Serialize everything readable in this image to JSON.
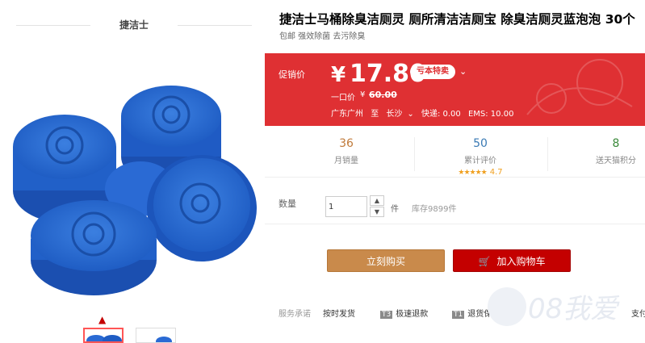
{
  "gallery": {
    "brand_name": "捷洁士",
    "thumb_up_icon": "chevron-up-icon"
  },
  "product": {
    "title": "捷洁士马桶除臭洁厕灵 厕所清洁洁厕宝 除臭洁厕灵蓝泡泡 30个",
    "subtitle": "包邮 强效除菌 去污除臭"
  },
  "price_box": {
    "label": "促销价",
    "currency": "¥",
    "price": "17.80",
    "badge": "亏本特卖",
    "original_label": "一口价",
    "original_currency": "¥",
    "original_price": "60.00",
    "origin": "广东广州",
    "to": "至",
    "destination": "长沙",
    "express": "快递: 0.00",
    "ems": "EMS: 10.00"
  },
  "stats": [
    {
      "value": "36",
      "label": "月销量"
    },
    {
      "value": "50",
      "label": "累计评价",
      "rating": "4.7"
    },
    {
      "value": "8",
      "label": "送天猫积分"
    }
  ],
  "quantity": {
    "label": "数量",
    "value": "1",
    "unit": "件",
    "stock": "库存9899件"
  },
  "actions": {
    "buy_now": "立刻购买",
    "add_cart": "加入购物车"
  },
  "service": {
    "label": "服务承诺",
    "items": [
      {
        "tag": "",
        "text": "按时发货"
      },
      {
        "tag": "T3",
        "text": "极速退款"
      },
      {
        "tag": "T1",
        "text": "退货保障卡"
      },
      {
        "tag": "",
        "text": "支付"
      }
    ]
  },
  "watermark": "08我爱"
}
